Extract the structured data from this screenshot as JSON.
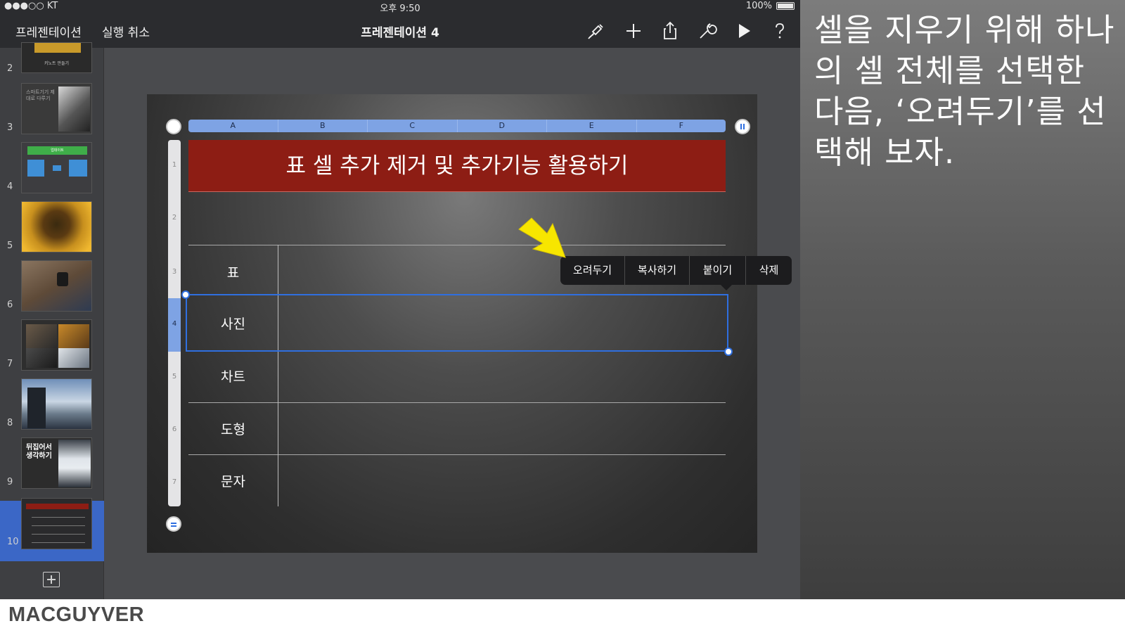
{
  "status_bar": {
    "carrier": "●●●○○ KT",
    "time": "오후 9:50",
    "battery": "100%"
  },
  "toolbar": {
    "presentations_label": "프레젠테이션",
    "undo_label": "실행 취소",
    "document_title": "프레젠테이션 4",
    "icons": [
      "brush-icon",
      "plus-icon",
      "share-icon",
      "wrench-icon",
      "play-icon",
      "help-icon"
    ]
  },
  "slides": {
    "numbers": [
      "2",
      "3",
      "4",
      "5",
      "6",
      "7",
      "8",
      "9",
      "10"
    ],
    "selected": "10",
    "thumb_text": {
      "s2": "키노트 만들기",
      "s3": "스마트기기 제대로 다루기",
      "s4": "업데이트",
      "s9": "뒤집어서 생각하기"
    }
  },
  "table": {
    "title": "표 셀 추가 제거 및 추가기능 활용하기",
    "columns": [
      "A",
      "B",
      "C",
      "D",
      "E",
      "F"
    ],
    "rows": [
      "1",
      "2",
      "3",
      "4",
      "5",
      "6",
      "7"
    ],
    "labels": [
      "표",
      "사진",
      "차트",
      "도형",
      "문자"
    ],
    "selected_row": "4"
  },
  "context_menu": {
    "items": [
      "오려두기",
      "복사하기",
      "붙이기",
      "삭제"
    ]
  },
  "caption": "셀을 지우기 위해 하나의 셀 전체를 선택한 다음, ‘오려두기’를 선택해 보자.",
  "brand": "MACGUYVER",
  "colors": {
    "accent": "#2f6fe0",
    "title_bar": "#8d1d14",
    "highlight_arrow": "#f7e600"
  }
}
